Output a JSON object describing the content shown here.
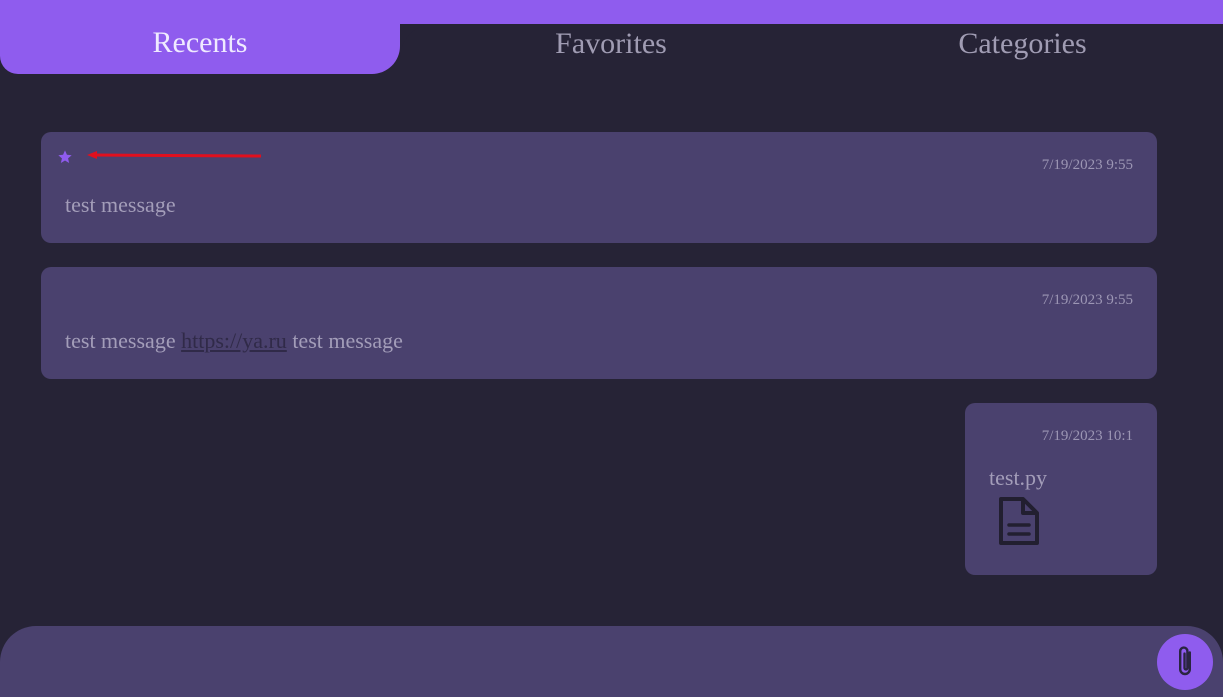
{
  "tabs": {
    "recents": "Recents",
    "favorites": "Favorites",
    "categories": "Categories",
    "active": "recents"
  },
  "messages": [
    {
      "timestamp": "7/19/2023 9:55",
      "text": "test message",
      "favorited": true
    },
    {
      "timestamp": "7/19/2023 9:55",
      "text_before": "test message ",
      "link": "https://ya.ru",
      "text_after": " test message",
      "favorited": false
    },
    {
      "timestamp": "7/19/2023 10:1",
      "file_name": "test.py",
      "file_icon": "document-icon"
    }
  ],
  "composer": {
    "placeholder": "",
    "value": "",
    "attach_icon": "paperclip-icon"
  },
  "colors": {
    "accent": "#8f5cee",
    "background": "#262336",
    "card": "#4a416e",
    "annotation_arrow": "#e0101e"
  },
  "icons": {
    "favorite": "star-icon"
  }
}
